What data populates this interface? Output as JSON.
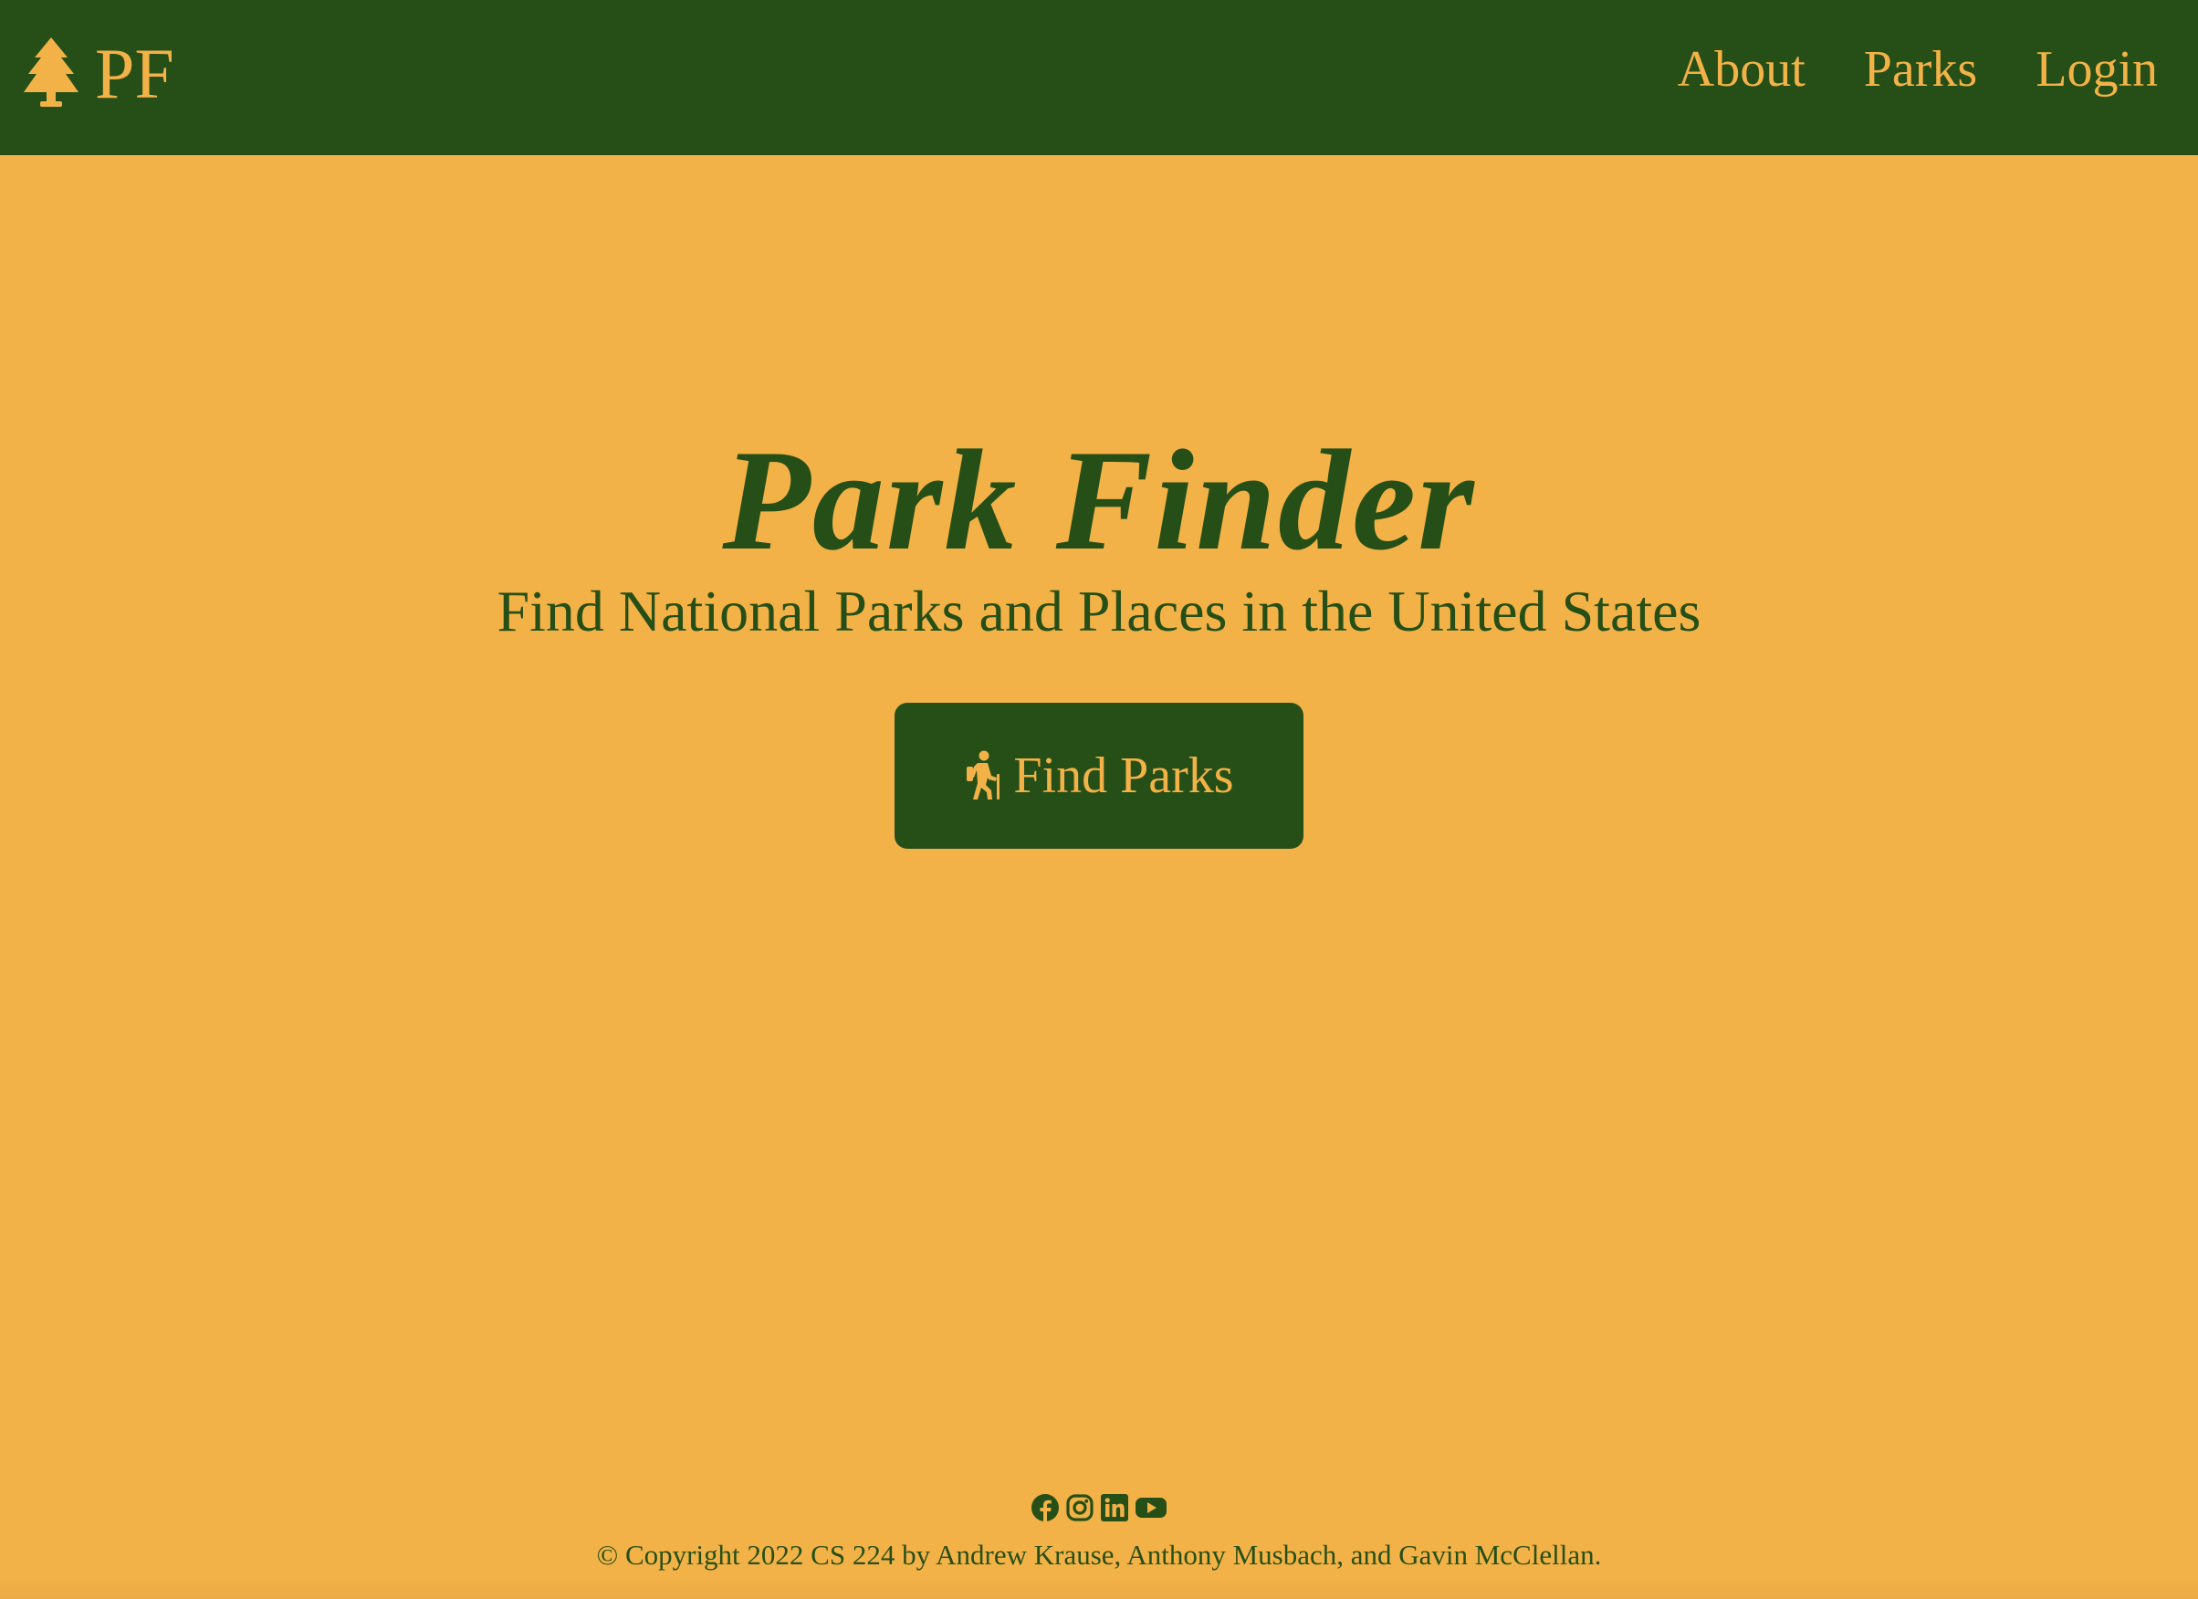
{
  "navbar": {
    "brand_icon": "tree-icon",
    "brand_text": "PF",
    "links": [
      {
        "label": "About"
      },
      {
        "label": "Parks"
      },
      {
        "label": "Login"
      }
    ]
  },
  "hero": {
    "title": "Park Finder",
    "subtitle": "Find National Parks and Places in the United States",
    "button": {
      "icon": "hiking-icon",
      "label": "Find Parks"
    }
  },
  "footer": {
    "social_icons": [
      "facebook-icon",
      "instagram-icon",
      "linkedin-icon",
      "youtube-icon"
    ],
    "copyright": "© Copyright 2022 CS 224 by Andrew Krause, Anthony Musbach, and Gavin McClellan."
  },
  "colors": {
    "background": "#f3b247",
    "primary": "#264f17"
  }
}
